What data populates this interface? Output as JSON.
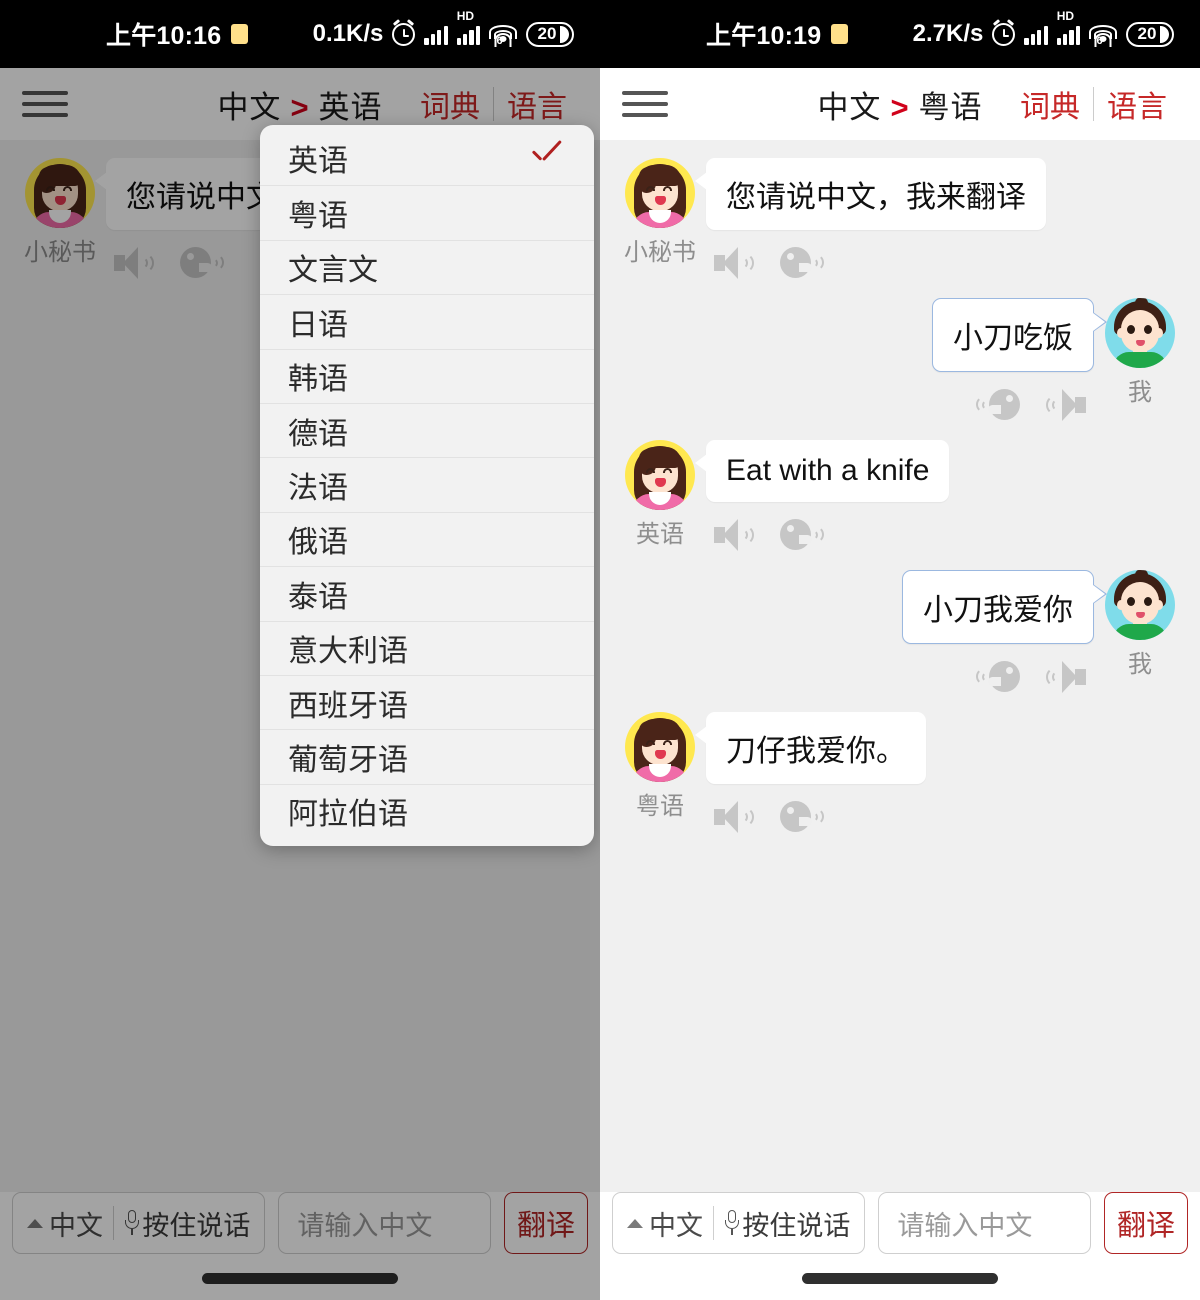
{
  "left": {
    "status": {
      "time": "上午10:16",
      "speed": "0.1K/s",
      "battery": "20",
      "hd_label": "HD",
      "wifi_gen": "6"
    },
    "header": {
      "source_lang": "中文",
      "arrow": ">",
      "target_lang": "英语",
      "dictionary": "词典",
      "language": "语言"
    },
    "messages": [
      {
        "side": "left",
        "name": "小秘书",
        "text": "您请说中文，我来翻译"
      }
    ],
    "dropdown": {
      "items": [
        {
          "label": "英语",
          "selected": true
        },
        {
          "label": "粤语",
          "selected": false
        },
        {
          "label": "文言文",
          "selected": false
        },
        {
          "label": "日语",
          "selected": false
        },
        {
          "label": "韩语",
          "selected": false
        },
        {
          "label": "德语",
          "selected": false
        },
        {
          "label": "法语",
          "selected": false
        },
        {
          "label": "俄语",
          "selected": false
        },
        {
          "label": "泰语",
          "selected": false
        },
        {
          "label": "意大利语",
          "selected": false
        },
        {
          "label": "西班牙语",
          "selected": false
        },
        {
          "label": "葡萄牙语",
          "selected": false
        },
        {
          "label": "阿拉伯语",
          "selected": false
        }
      ]
    },
    "bottom": {
      "voice_lang": "中文",
      "hold_to_talk": "按住说话",
      "input_placeholder": "请输入中文",
      "input_value": "",
      "translate": "翻译"
    }
  },
  "right": {
    "status": {
      "time": "上午10:19",
      "speed": "2.7K/s",
      "battery": "20",
      "hd_label": "HD",
      "wifi_gen": "6"
    },
    "header": {
      "source_lang": "中文",
      "arrow": ">",
      "target_lang": "粤语",
      "dictionary": "词典",
      "language": "语言"
    },
    "messages": [
      {
        "side": "left",
        "name": "小秘书",
        "text": "您请说中文，我来翻译"
      },
      {
        "side": "right",
        "name": "我",
        "text": "小刀吃饭"
      },
      {
        "side": "left",
        "name": "英语",
        "text": "Eat with a knife"
      },
      {
        "side": "right",
        "name": "我",
        "text": "小刀我爱你"
      },
      {
        "side": "left",
        "name": "粤语",
        "text": "刀仔我爱你。"
      }
    ],
    "bottom": {
      "voice_lang": "中文",
      "hold_to_talk": "按住说话",
      "input_placeholder": "请输入中文",
      "input_value": "",
      "translate": "翻译"
    }
  },
  "colors": {
    "accent_red": "#c62828",
    "arrow_red": "#d0021b",
    "check_red": "#b02020",
    "chat_bg": "#f0f0f0",
    "bubble_bg": "#ffffff",
    "me_border": "#9bb8e0"
  }
}
